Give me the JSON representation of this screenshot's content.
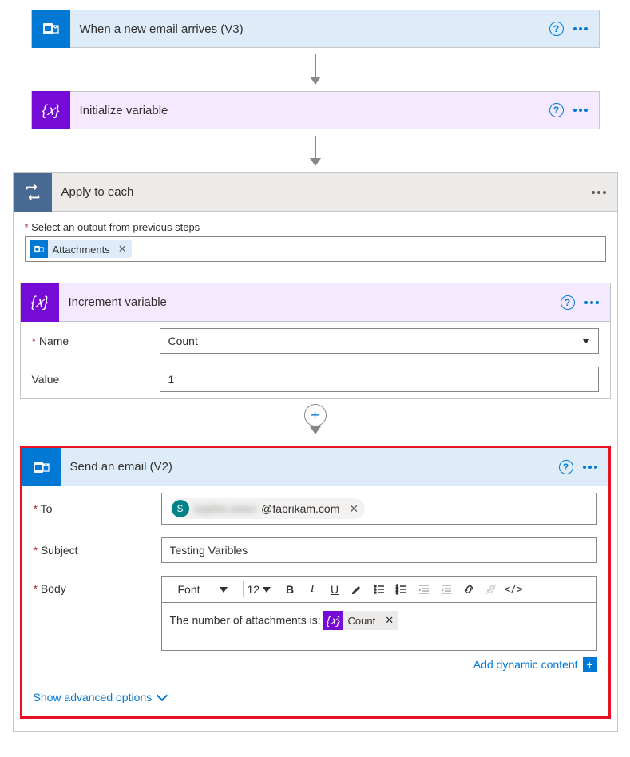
{
  "trigger": {
    "title": "When a new email arrives (V3)"
  },
  "init_var": {
    "title": "Initialize variable"
  },
  "apply_each": {
    "title": "Apply to each",
    "select_label": "Select an output from previous steps",
    "token_label": "Attachments"
  },
  "increment": {
    "title": "Increment variable",
    "name_label": "Name",
    "name_value": "Count",
    "value_label": "Value",
    "value_value": "1"
  },
  "send_email": {
    "title": "Send an email (V2)",
    "to_label": "To",
    "to_avatar": "S",
    "to_hidden": "sophie.owen",
    "to_domain": "@fabrikam.com",
    "subject_label": "Subject",
    "subject_value": "Testing Varibles",
    "body_label": "Body",
    "font_label": "Font",
    "font_size": "12",
    "body_prefix": "The number of attachments is: ",
    "body_token": "Count",
    "dynamic_link": "Add dynamic content",
    "advanced_link": "Show advanced options"
  }
}
